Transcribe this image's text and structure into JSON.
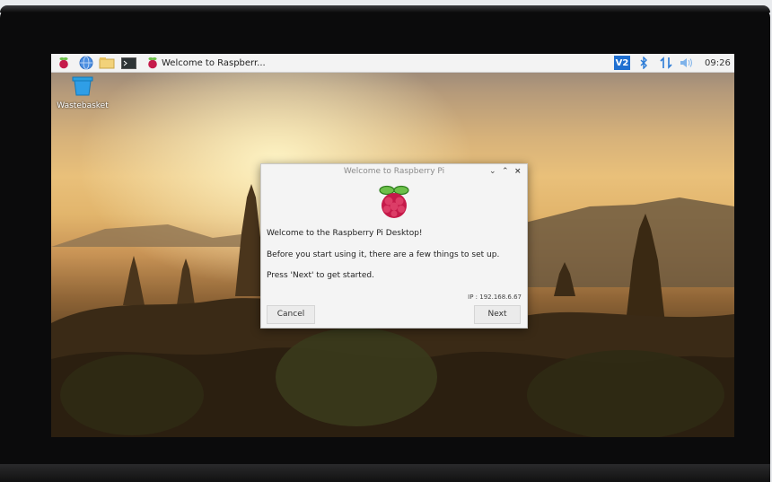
{
  "taskbar": {
    "window_title": "Welcome to Raspberr...",
    "clock": "09:26",
    "vnc_label": "V2",
    "colors": {
      "raspberry_red": "#c51a4a",
      "leaf_green": "#6cc04a",
      "accent_blue": "#2b7bd6"
    }
  },
  "desktop": {
    "wastebasket_label": "Wastebasket"
  },
  "dialog": {
    "title": "Welcome to Raspberry Pi",
    "line1": "Welcome to the Raspberry Pi Desktop!",
    "line2": "Before you start using it, there are a few things to set up.",
    "line3": "Press 'Next' to get started.",
    "ip": "IP : 192.168.6.67",
    "cancel_label": "Cancel",
    "next_label": "Next"
  }
}
